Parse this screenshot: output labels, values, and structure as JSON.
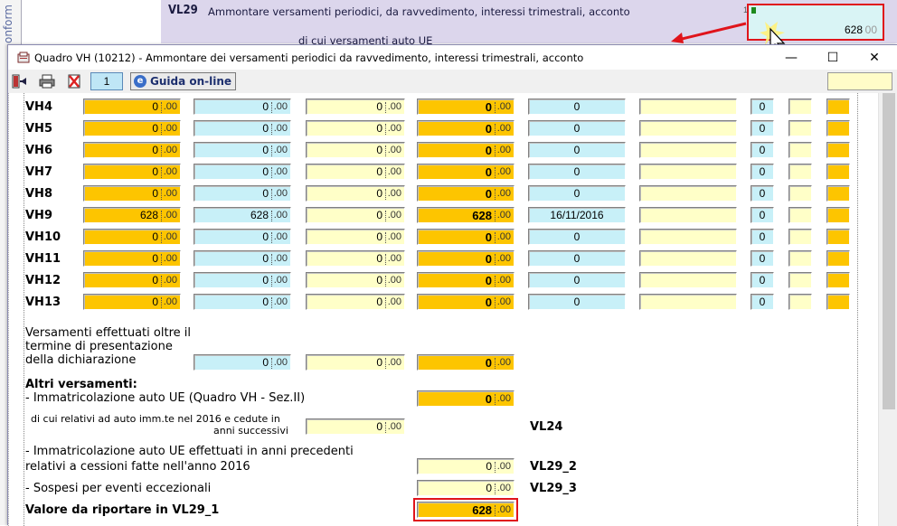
{
  "background": {
    "sidebar_text": "onform",
    "code": "VL29",
    "description": "Ammontare versamenti periodici, da ravvedimento, interessi trimestrali, acconto",
    "sub_description": "di cui versamenti auto UE",
    "field_marker": "1",
    "field_value": "628",
    "field_decimals": "00"
  },
  "dialog": {
    "title": "Quadro VH (10212) - Ammontare dei versamenti periodici da ravvedimento,  interessi trimestrali, acconto",
    "minimize": "—",
    "maximize": "☐",
    "close": "✕"
  },
  "toolbar": {
    "page": "1",
    "guide_icon": "e",
    "guide_label": "Guida on-line"
  },
  "decimal_suffix": ".00",
  "rows": [
    {
      "label": "VH4",
      "c1": "0",
      "c2": "0",
      "c3": "0",
      "c4": "0",
      "c5": "0",
      "c7": "0"
    },
    {
      "label": "VH5",
      "c1": "0",
      "c2": "0",
      "c3": "0",
      "c4": "0",
      "c5": "0",
      "c7": "0"
    },
    {
      "label": "VH6",
      "c1": "0",
      "c2": "0",
      "c3": "0",
      "c4": "0",
      "c5": "0",
      "c7": "0"
    },
    {
      "label": "VH7",
      "c1": "0",
      "c2": "0",
      "c3": "0",
      "c4": "0",
      "c5": "0",
      "c7": "0"
    },
    {
      "label": "VH8",
      "c1": "0",
      "c2": "0",
      "c3": "0",
      "c4": "0",
      "c5": "0",
      "c7": "0"
    },
    {
      "label": "VH9",
      "c1": "628",
      "c2": "628",
      "c3": "0",
      "c4": "628",
      "c5": "16/11/2016",
      "c7": "0"
    },
    {
      "label": "VH10",
      "c1": "0",
      "c2": "0",
      "c3": "0",
      "c4": "0",
      "c5": "0",
      "c7": "0"
    },
    {
      "label": "VH11",
      "c1": "0",
      "c2": "0",
      "c3": "0",
      "c4": "0",
      "c5": "0",
      "c7": "0"
    },
    {
      "label": "VH12",
      "c1": "0",
      "c2": "0",
      "c3": "0",
      "c4": "0",
      "c5": "0",
      "c7": "0"
    },
    {
      "label": "VH13",
      "c1": "0",
      "c2": "0",
      "c3": "0",
      "c4": "0",
      "c5": "0",
      "c7": "0"
    }
  ],
  "late_payments": {
    "label_line1": "Versamenti effettuati oltre il",
    "label_line2": "termine di presentazione",
    "label_line3": "della dichiarazione",
    "c2": "0",
    "c3": "0",
    "c4": "0"
  },
  "others": {
    "heading": "Altri versamenti:",
    "immatricolazione_label": "- Immatricolazione auto UE (Quadro VH - Sez.II)",
    "immatricolazione_value": "0",
    "ceduti_line1": "di cui relativi ad auto imm.te nel 2016 e cedute in",
    "ceduti_line2": "anni successivi",
    "ceduti_value": "0",
    "ceduti_tag": "VL24",
    "prec_line1": "- Immatricolazione auto UE effettuati in anni precedenti",
    "prec_line2": "relativi a cessioni fatte nell'anno 2016",
    "prec_value": "0",
    "prec_tag": "VL29_2",
    "sospesi_label": "- Sospesi per eventi eccezionali",
    "sospesi_value": "0",
    "sospesi_tag": "VL29_3",
    "totale_label": "Valore da riportare in VL29_1",
    "totale_value": "628"
  },
  "colors": {
    "orange": "#fdc500",
    "cyan": "#c8f0f8",
    "yellow": "#ffffc8",
    "highlight": "#e0141b"
  }
}
